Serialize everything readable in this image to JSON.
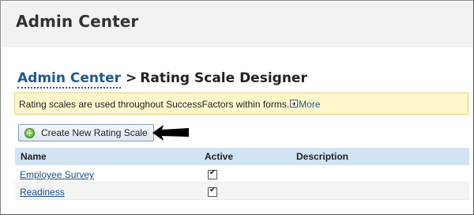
{
  "app": {
    "title": "Admin Center"
  },
  "breadcrumb": {
    "parent": "Admin Center",
    "separator": ">",
    "current": "Rating Scale Designer"
  },
  "info_bar": {
    "text": "Rating scales are used throughout SuccessFactors within forms.",
    "more_label": "More"
  },
  "toolbar": {
    "create_label": "Create New Rating Scale"
  },
  "table": {
    "columns": [
      "Name",
      "Active",
      "Description"
    ],
    "rows": [
      {
        "name": "Employee Survey",
        "active": true,
        "description": ""
      },
      {
        "name": "Readiness",
        "active": true,
        "description": ""
      }
    ]
  },
  "colors": {
    "link": "#1c5a8c",
    "info_bar_bg": "#fff6cc",
    "table_header_bg": "#d2e3f3"
  }
}
